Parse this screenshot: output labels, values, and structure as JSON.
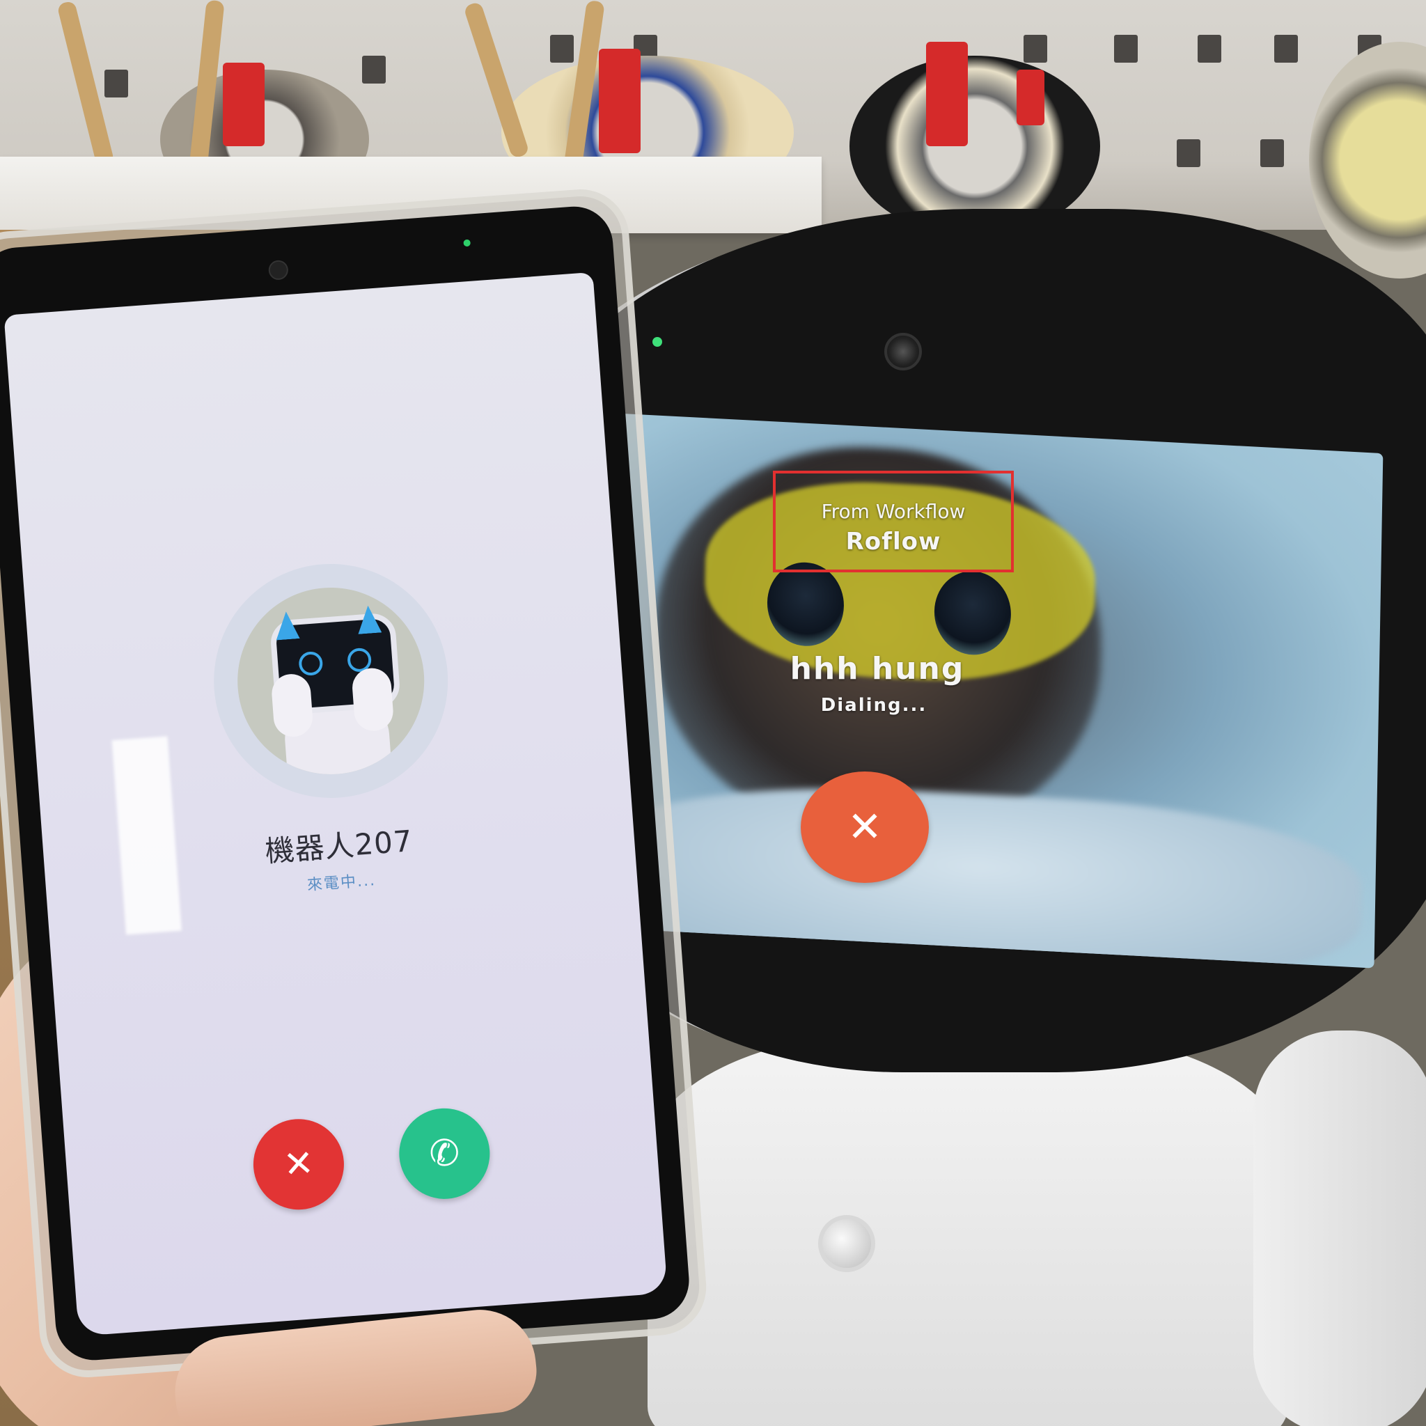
{
  "robot_screen": {
    "source_label": "From Workflow",
    "source_name": "Roflow",
    "callee_name": "hhh hung",
    "call_status": "Dialing...",
    "end_call_glyph": "✕",
    "end_call_color": "#e8603c",
    "highlight_color": "#e23030"
  },
  "phone_screen": {
    "caller_name": "機器人207",
    "call_status": "來電中...",
    "decline_glyph": "✕",
    "accept_glyph": "✆",
    "decline_color": "#e23434",
    "accept_color": "#27c28c",
    "status_color": "#5b8ec4"
  },
  "icons": [
    "close-icon",
    "phone-icon",
    "robot-avatar-icon"
  ]
}
